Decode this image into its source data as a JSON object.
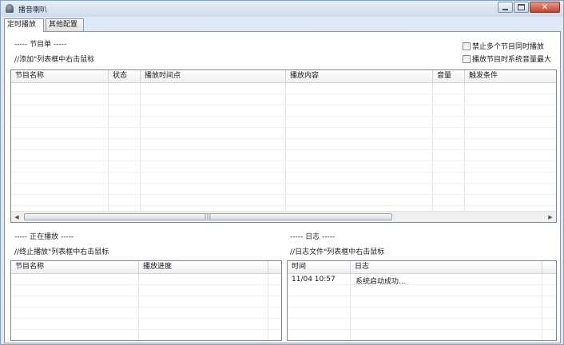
{
  "window": {
    "title": "播音喇叭"
  },
  "tabs": [
    {
      "label": "定时播放",
      "active": true
    },
    {
      "label": "其他配置",
      "active": false
    }
  ],
  "program_section": {
    "title": "----- 节目单 -----",
    "hint": "//添加\"列表框中右击鼠标",
    "options": [
      {
        "label": "禁止多个节目同时播放",
        "checked": false
      },
      {
        "label": "播放节目时系统音量最大",
        "checked": false
      }
    ],
    "columns": [
      "节目名称",
      "状态",
      "播放时间点",
      "播放内容",
      "音量",
      "触发条件"
    ],
    "rows": []
  },
  "playing_section": {
    "title": "----- 正在播放 -----",
    "hint": "//终止播放\"列表框中右击鼠标",
    "columns": [
      "节目名称",
      "播放进度"
    ],
    "rows": []
  },
  "log_section": {
    "title": "----- 日志 -----",
    "hint": "//日志文件\"列表框中右击鼠标",
    "columns": [
      "时间",
      "日志"
    ],
    "rows": [
      {
        "time": "11/04 10:57",
        "message": "系统启动成功..."
      }
    ]
  },
  "scrollbar_grip": "|||"
}
